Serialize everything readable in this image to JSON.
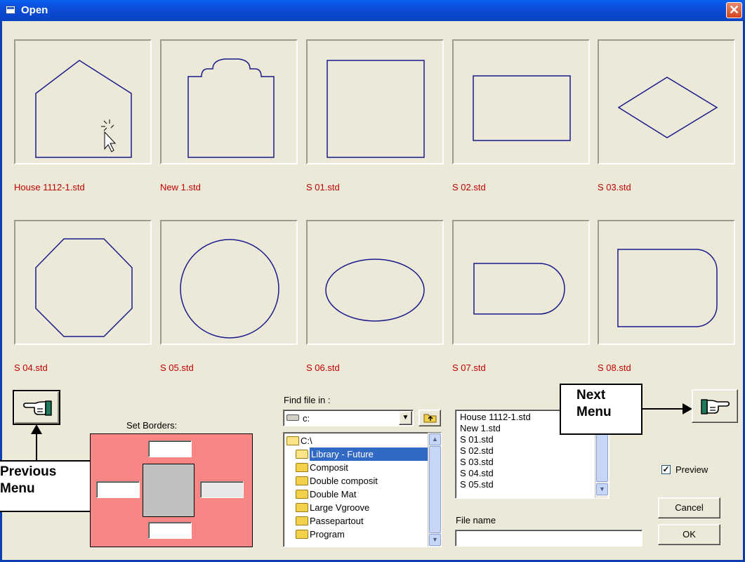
{
  "window": {
    "title": "Open",
    "close_glyph": "✕"
  },
  "thumbnails": [
    {
      "label": "House 1112-1.std",
      "shape": "house"
    },
    {
      "label": "New 1.std",
      "shape": "arched"
    },
    {
      "label": "S 01.std",
      "shape": "square"
    },
    {
      "label": "S 02.std",
      "shape": "rectangle"
    },
    {
      "label": "S 03.std",
      "shape": "diamond"
    },
    {
      "label": "S 04.std",
      "shape": "octagon"
    },
    {
      "label": "S 05.std",
      "shape": "circle"
    },
    {
      "label": "S 06.std",
      "shape": "ellipse"
    },
    {
      "label": "S 07.std",
      "shape": "round-right-small"
    },
    {
      "label": "S 08.std",
      "shape": "round-right-large"
    }
  ],
  "shape_color": "#1a1a8c",
  "nav": {
    "previous_icon": "hand-pointing-left-icon",
    "next_icon": "hand-pointing-right-icon",
    "previous_callout": [
      "Previous",
      "Menu"
    ],
    "next_callout": [
      "Next",
      "Menu"
    ]
  },
  "borders": {
    "label": "Set Borders:",
    "panel_color": "#f98585",
    "top": "",
    "left": "",
    "right": "",
    "bottom": ""
  },
  "find": {
    "label": "Find file in :",
    "drive": "c:",
    "tree": [
      {
        "label": "C:\\",
        "level": 0,
        "open": true,
        "selected": false
      },
      {
        "label": "Library - Future",
        "level": 1,
        "open": true,
        "selected": true
      },
      {
        "label": "Composit",
        "level": 1,
        "open": false,
        "selected": false
      },
      {
        "label": "Double composit",
        "level": 1,
        "open": false,
        "selected": false
      },
      {
        "label": "Double Mat",
        "level": 1,
        "open": false,
        "selected": false
      },
      {
        "label": "Large Vgroove",
        "level": 1,
        "open": false,
        "selected": false
      },
      {
        "label": "Passepartout",
        "level": 1,
        "open": false,
        "selected": false
      },
      {
        "label": "Program",
        "level": 1,
        "open": false,
        "selected": false
      }
    ]
  },
  "files": [
    "House 1112-1.std",
    "New 1.std",
    "S 01.std",
    "S 02.std",
    "S 03.std",
    "S 04.std",
    "S 05.std"
  ],
  "preview": {
    "label": "Preview",
    "checked": true
  },
  "filename": {
    "label": "File name",
    "value": ""
  },
  "buttons": {
    "cancel": "Cancel",
    "ok": "OK"
  },
  "colors": {
    "selection": "#316ac5",
    "label_red": "#c00000",
    "title_blue": "#0a4ed8"
  }
}
